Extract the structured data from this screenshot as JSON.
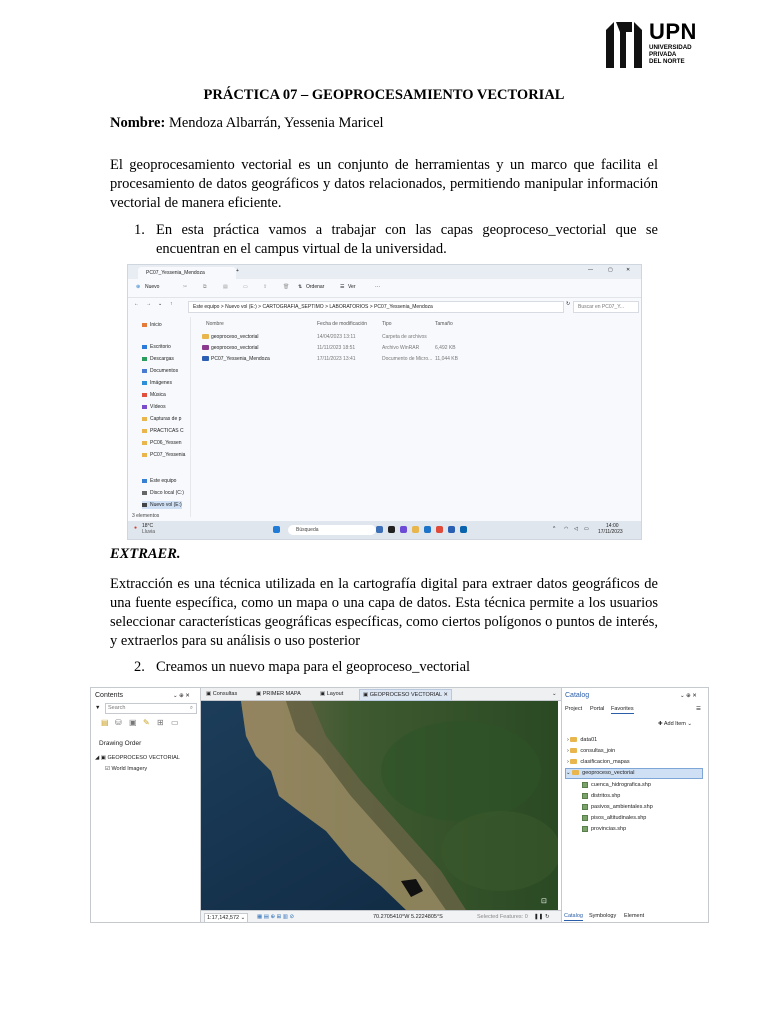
{
  "logo": {
    "big": "UPN",
    "line1": "UNIVERSIDAD",
    "line2": "PRIVADA",
    "line3": "DEL NORTE"
  },
  "title": "PRÁCTICA 07 – GEOPROCESAMIENTO VECTORIAL",
  "name_label": "Nombre:",
  "name_value": "Mendoza Albarrán, Yessenia Maricel",
  "intro": "El geoprocesamiento vectorial es un conjunto de herramientas y un marco que facilita el procesamiento de datos geográficos y datos relacionados, permitiendo manipular información vectorial de manera eficiente.",
  "step1_num": "1.",
  "step1": "En esta práctica vamos a trabajar con las capas geoproceso_vectorial que se encuentran en el campus virtual de la universidad.",
  "section_heading": "EXTRAER.",
  "extract_para": "Extracción es una técnica utilizada en la cartografía digital para extraer datos geográficos de una fuente específica, como un mapa o una capa de datos. Esta técnica permite a los usuarios seleccionar características geográficas específicas, como ciertos polígonos o puntos de interés, y extraerlos para su análisis o uso posterior",
  "step2_num": "2.",
  "step2": "Creamos un nuevo mapa para el geoproceso_vectorial",
  "explorer": {
    "tab_title": "PC07_Yessenia_Mendoza",
    "new_button": "Nuevo",
    "sort_button": "Ordenar",
    "view_button": "Ver",
    "breadcrumb": "Este equipo  >  Nuevo vol (E:)  >  CARTOGRAFIA_SEPTIMO  >  LABORATORIOS  >  PC07_Yessenia_Mendoza",
    "search_placeholder": "Buscar en PC07_Y...",
    "nav": [
      "Inicio",
      "Escritorio",
      "Descargas",
      "Documentos",
      "Imágenes",
      "Música",
      "Vídeos",
      "Capturas de p",
      "PRACTICAS C",
      "PC06_Yessen",
      "PC07_Yessenia",
      "Este equipo",
      "Disco local (C:)",
      "Nuevo vol (E:)"
    ],
    "columns": [
      "Nombre",
      "Fecha de modificación",
      "Tipo",
      "Tamaño"
    ],
    "files": [
      {
        "name": "geoproceso_vectorial",
        "date": "14/04/2023 13:11",
        "type": "Carpeta de archivos",
        "size": ""
      },
      {
        "name": "geoproceso_vectorial",
        "date": "11/11/2023 18:51",
        "type": "Archivo WinRAR",
        "size": "6,492 KB"
      },
      {
        "name": "PC07_Yessenia_Mendoza",
        "date": "17/11/2023 13:41",
        "type": "Documento de Micro...",
        "size": "11,044 KB"
      }
    ],
    "status": "3 elementos",
    "weather_temp": "18°C",
    "weather_desc": "Lluvia",
    "taskbar_search": "Búsqueda",
    "clock_time": "14:00",
    "clock_date": "17/11/2023"
  },
  "arcgis": {
    "contents_title": "Contents",
    "search_placeholder": "Search",
    "drawing_order": "Drawing Order",
    "map_layer": "GEOPROCESO VECTORIAL",
    "basemap": "World Imagery",
    "tabs": [
      "Consultas",
      "PRIMER MAPA",
      "Layout",
      "GEOPROCESO VECTORIAL"
    ],
    "scale": "1:17,142,572",
    "coords": "70.2705410°W 5.2224805°S",
    "selected": "Selected Features: 0",
    "catalog_title": "Catalog",
    "catalog_tabs": [
      "Project",
      "Portal",
      "Favorites"
    ],
    "add_item": "Add Item",
    "folders": [
      "data01",
      "consultas_join",
      "clasificacion_mapas",
      "geoproceso_vectorial"
    ],
    "shapefiles": [
      "cuenca_hidrografica.shp",
      "distritos.shp",
      "pasivos_ambientales.shp",
      "pisos_altitudinales.shp",
      "provincias.shp"
    ],
    "bottom_tabs": [
      "Catalog",
      "Symbology",
      "Element"
    ]
  }
}
